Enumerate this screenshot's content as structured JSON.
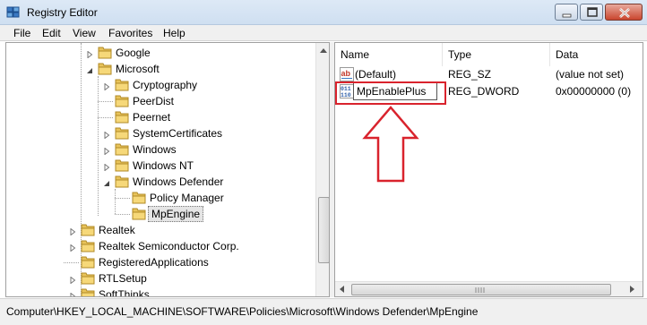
{
  "window": {
    "title": "Registry Editor"
  },
  "menu": [
    "File",
    "Edit",
    "View",
    "Favorites",
    "Help"
  ],
  "tree": [
    {
      "label": "Google",
      "expander": "collapsed"
    },
    {
      "label": "Microsoft",
      "expander": "expanded"
    },
    {
      "label": "Cryptography",
      "expander": "collapsed"
    },
    {
      "label": "PeerDist",
      "expander": "none"
    },
    {
      "label": "Peernet",
      "expander": "none"
    },
    {
      "label": "SystemCertificates",
      "expander": "collapsed"
    },
    {
      "label": "Windows",
      "expander": "collapsed"
    },
    {
      "label": "Windows NT",
      "expander": "collapsed"
    },
    {
      "label": "Windows Defender",
      "expander": "expanded"
    },
    {
      "label": "Policy Manager",
      "expander": "none"
    },
    {
      "label": "MpEngine",
      "expander": "none",
      "selected": true
    },
    {
      "label": "Realtek",
      "expander": "collapsed"
    },
    {
      "label": "Realtek Semiconductor Corp.",
      "expander": "collapsed"
    },
    {
      "label": "RegisteredApplications",
      "expander": "none"
    },
    {
      "label": "RTLSetup",
      "expander": "collapsed"
    },
    {
      "label": "SoftThinks",
      "expander": "collapsed"
    }
  ],
  "list": {
    "columns": [
      "Name",
      "Type",
      "Data"
    ],
    "rows": [
      {
        "name": "(Default)",
        "type": "REG_SZ",
        "data": "(value not set)",
        "icon": "string-value-icon"
      },
      {
        "name": "MpEnablePlus",
        "type": "REG_DWORD",
        "data": "0x00000000 (0)",
        "icon": "binary-value-icon",
        "editing": true
      }
    ]
  },
  "status": {
    "path": "Computer\\HKEY_LOCAL_MACHINE\\SOFTWARE\\Policies\\Microsoft\\Windows Defender\\MpEngine"
  },
  "colors": {
    "highlight": "#d9232d",
    "titlebar": "#dde9f6"
  }
}
